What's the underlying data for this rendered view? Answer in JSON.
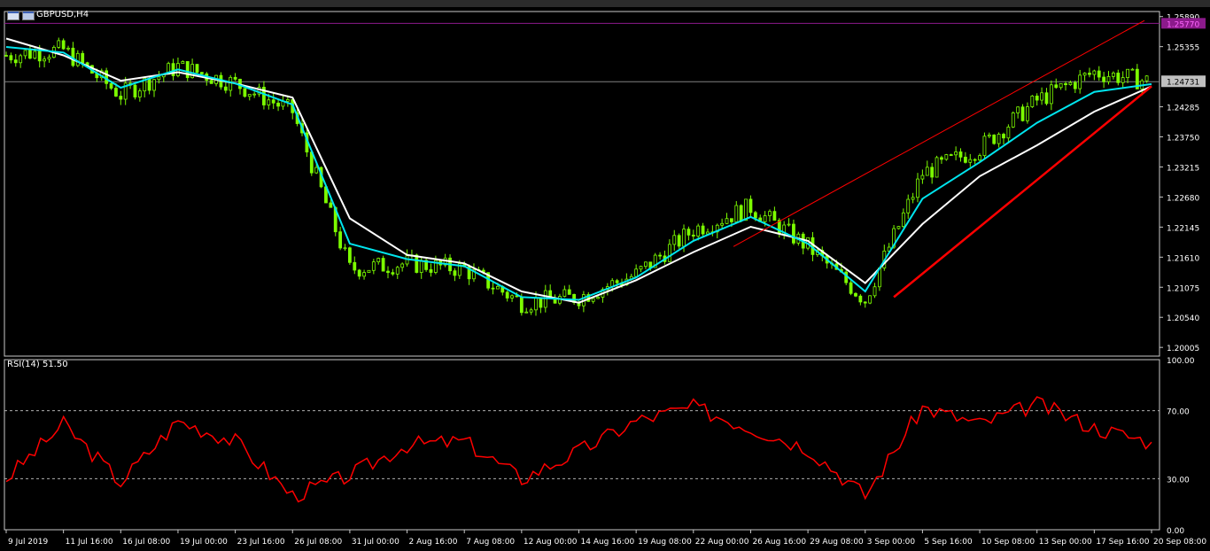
{
  "window": {
    "symbol_label": "GBPUSD,H4"
  },
  "rsi": {
    "label": "RSI(14) 51.50",
    "levels": [
      "100.00",
      "70.00",
      "30.00",
      "0.00"
    ]
  },
  "price_axis": {
    "ticks": [
      "1.25890",
      "1.25355",
      "1.24285",
      "1.23750",
      "1.23215",
      "1.22680",
      "1.22145",
      "1.21610",
      "1.21075",
      "1.20540",
      "1.20005"
    ],
    "current_price_label": "1.24731",
    "top_level_label": "1.25770"
  },
  "time_axis": {
    "ticks": [
      "9 Jul 2019",
      "11 Jul 16:00",
      "16 Jul 08:00",
      "19 Jul 00:00",
      "23 Jul 16:00",
      "26 Jul 08:00",
      "31 Jul 00:00",
      "2 Aug 16:00",
      "7 Aug 08:00",
      "12 Aug 00:00",
      "14 Aug 16:00",
      "19 Aug 08:00",
      "22 Aug 00:00",
      "26 Aug 16:00",
      "29 Aug 08:00",
      "3 Sep 00:00",
      "5 Sep 16:00",
      "10 Sep 08:00",
      "13 Sep 00:00",
      "17 Sep 16:00",
      "20 Sep 08:00"
    ]
  },
  "colors": {
    "background": "#000000",
    "candle": "#7cfc00",
    "ma_fast": "#00e5ee",
    "ma_slow": "#ffffff",
    "rsi_line": "#ff0000",
    "trend_line": "#ff0000",
    "grid_line": "#808080",
    "current_price_bg": "#c0c0c0",
    "top_level_bg": "#8b1a8b"
  },
  "chart_data": [
    {
      "type": "line",
      "panel": "price",
      "ylim": [
        1.1985,
        1.2598
      ],
      "x": [
        "9 Jul 2019",
        "11 Jul 16:00",
        "16 Jul 08:00",
        "19 Jul 00:00",
        "23 Jul 16:00",
        "26 Jul 08:00",
        "31 Jul 00:00",
        "2 Aug 16:00",
        "7 Aug 08:00",
        "12 Aug 00:00",
        "14 Aug 16:00",
        "19 Aug 08:00",
        "22 Aug 00:00",
        "26 Aug 16:00",
        "29 Aug 08:00",
        "3 Sep 00:00",
        "5 Sep 16:00",
        "10 Sep 08:00",
        "13 Sep 00:00",
        "17 Sep 16:00",
        "20 Sep 08:00"
      ],
      "series": [
        {
          "name": "",
          "values": [
            1.252,
            1.253,
            1.245,
            1.25,
            1.247,
            1.242,
            1.214,
            1.215,
            1.214,
            1.208,
            1.209,
            1.213,
            1.221,
            1.225,
            1.218,
            1.2085,
            1.231,
            1.2355,
            1.244,
            1.249,
            1.2473
          ]
        },
        {
          "name": "",
          "values": [
            1.255,
            1.252,
            1.2475,
            1.249,
            1.247,
            1.2445,
            1.223,
            1.2165,
            1.215,
            1.21,
            1.208,
            1.212,
            1.217,
            1.2215,
            1.219,
            1.2115,
            1.222,
            1.2305,
            1.236,
            1.242,
            1.2465
          ]
        }
      ]
    },
    {
      "type": "line",
      "panel": "rsi",
      "ylim": [
        0,
        100
      ],
      "x": [
        "9 Jul 2019",
        "11 Jul 16:00",
        "16 Jul 08:00",
        "19 Jul 00:00",
        "23 Jul 16:00",
        "26 Jul 08:00",
        "31 Jul 00:00",
        "2 Aug 16:00",
        "7 Aug 08:00",
        "12 Aug 00:00",
        "14 Aug 16:00",
        "19 Aug 08:00",
        "22 Aug 00:00",
        "26 Aug 16:00",
        "29 Aug 08:00",
        "3 Sep 00:00",
        "5 Sep 16:00",
        "10 Sep 08:00",
        "13 Sep 00:00",
        "17 Sep 16:00",
        "20 Sep 08:00"
      ],
      "series": [
        {
          "name": "",
          "values": [
            30,
            62,
            28,
            64,
            52,
            20,
            32,
            50,
            52,
            30,
            46,
            64,
            72,
            60,
            48,
            20,
            72,
            62,
            74,
            60,
            51.5
          ]
        }
      ]
    }
  ]
}
